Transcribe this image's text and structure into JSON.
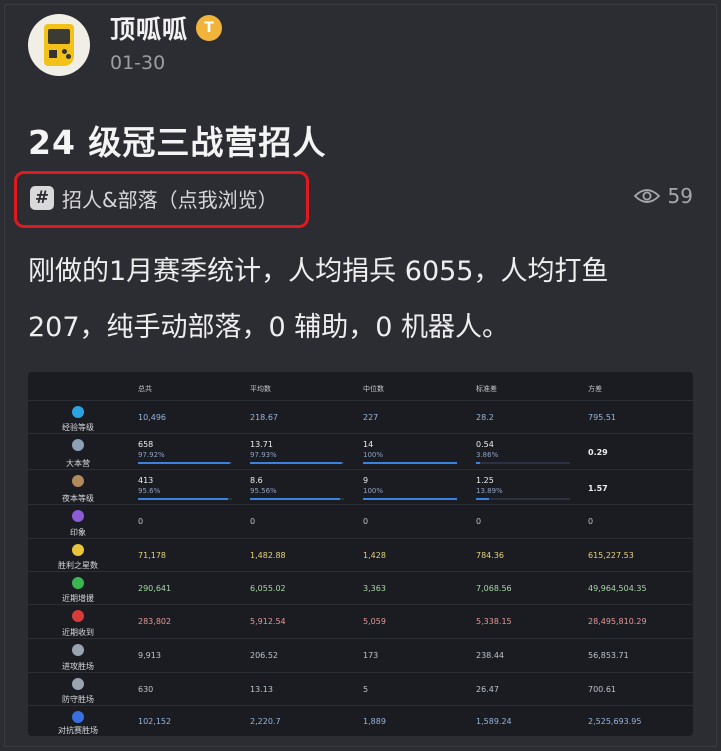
{
  "post": {
    "username": "顶呱呱",
    "badge": "T",
    "date": "01-30",
    "title": "24 级冠三战营招人",
    "topic": "招人&部落（点我浏览）",
    "topic_icon": "#",
    "views": "59",
    "body_line1": "刚做的1月赛季统计，人均捐兵 6055，人均打鱼",
    "body_line2": "207，纯手动部落，0 辅助，0 机器人。"
  },
  "stats": {
    "headers": [
      "总共",
      "平均数",
      "中位数",
      "标准差",
      "方差"
    ],
    "rows": [
      {
        "label": "经验等级",
        "icon": "diamond-icon",
        "icon_color": "#2aa3e0",
        "color": "#9ab4dc",
        "values": [
          "10,496",
          "218.67",
          "227",
          "28.2",
          "795.51"
        ]
      },
      {
        "label": "大本营",
        "icon": "town-hall-icon",
        "icon_color": "#8ca0b8",
        "color": "#eeeeee",
        "values": [
          "658",
          "13.71",
          "14",
          "0.54",
          "0.29"
        ],
        "pcts": [
          "97.92%",
          "97.93%",
          "100%",
          "3.86%"
        ],
        "fills": [
          0.979,
          0.979,
          1.0,
          0.039
        ]
      },
      {
        "label": "夜本等级",
        "icon": "builder-hall-icon",
        "icon_color": "#b08a5a",
        "color": "#eeeeee",
        "values": [
          "413",
          "8.6",
          "9",
          "1.25",
          "1.57"
        ],
        "pcts": [
          "95.6%",
          "95.56%",
          "100%",
          "13.89%"
        ],
        "fills": [
          0.956,
          0.956,
          1.0,
          0.139
        ]
      },
      {
        "label": "印象",
        "icon": "thumbs-up-icon",
        "icon_color": "#8b5cd6",
        "color": "#bfc3cc",
        "values": [
          "0",
          "0",
          "0",
          "0",
          "0"
        ]
      },
      {
        "label": "胜利之星数",
        "icon": "star-icon",
        "icon_color": "#e8c53a",
        "color": "#e6d27a",
        "values": [
          "71,178",
          "1,482.88",
          "1,428",
          "784.36",
          "615,227.53"
        ]
      },
      {
        "label": "近期增援",
        "icon": "arrow-up-icon",
        "icon_color": "#3bb552",
        "color": "#a8d8a6",
        "values": [
          "290,641",
          "6,055.02",
          "3,363",
          "7,068.56",
          "49,964,504.35"
        ]
      },
      {
        "label": "近期收到",
        "icon": "arrow-down-icon",
        "icon_color": "#d93a3a",
        "color": "#e39a96",
        "values": [
          "283,802",
          "5,912.54",
          "5,059",
          "5,338.15",
          "28,495,810.29"
        ]
      },
      {
        "label": "进攻胜场",
        "icon": "swords-icon",
        "icon_color": "#9aa3b0",
        "color": "#bfc3cc",
        "values": [
          "9,913",
          "206.52",
          "173",
          "238.44",
          "56,853.71"
        ]
      },
      {
        "label": "防守胜场",
        "icon": "shield-icon",
        "icon_color": "#9aa3b0",
        "color": "#bfc3cc",
        "values": [
          "630",
          "13.13",
          "5",
          "26.47",
          "700.61"
        ]
      },
      {
        "label": "对抗赛胜场",
        "icon": "versus-icon",
        "icon_color": "#3a6fe0",
        "color": "#9ab4dc",
        "values": [
          "102,152",
          "2,220.7",
          "1,889",
          "1,589.24",
          "2,525,693.95"
        ]
      }
    ]
  }
}
